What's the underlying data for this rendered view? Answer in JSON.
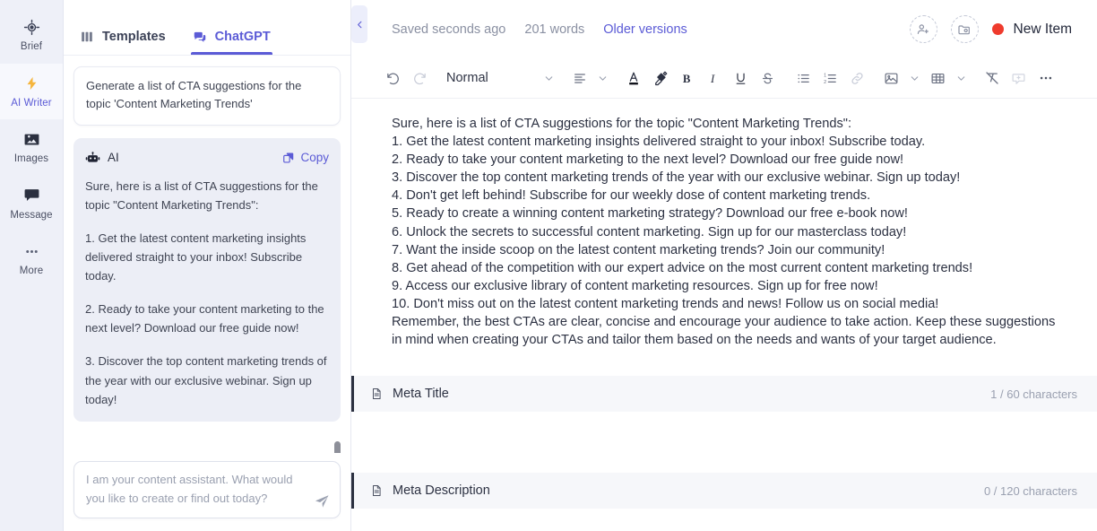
{
  "rail": {
    "items": [
      {
        "label": "Brief",
        "icon": "target-icon",
        "active": false
      },
      {
        "label": "AI Writer",
        "icon": "lightning-bolt-icon",
        "active": true
      },
      {
        "label": "Images",
        "icon": "image-icon",
        "active": false
      },
      {
        "label": "Message",
        "icon": "chat-bubble-icon",
        "active": false
      },
      {
        "label": "More",
        "icon": "ellipsis-icon",
        "active": false
      }
    ]
  },
  "chat": {
    "tabs": [
      {
        "label": "Templates",
        "icon": "grid-icon",
        "active": false
      },
      {
        "label": "ChatGPT",
        "icon": "chat-bubbles-icon",
        "active": true
      }
    ],
    "user_message": "Generate a list of CTA suggestions for the topic 'Content Marketing Trends'",
    "ai_name": "AI",
    "copy_label": "Copy",
    "ai_paragraphs": [
      "Sure, here is a list of CTA suggestions for the topic \"Content Marketing Trends\":",
      "1. Get the latest content marketing insights delivered straight to your inbox! Subscribe today.",
      "2. Ready to take your content marketing to the next level? Download our free guide now!",
      "3. Discover the top content marketing trends of the year with our exclusive webinar. Sign up today!"
    ],
    "input_placeholder": "I am your content assistant. What would you like to create or find out today?",
    "input_value": "",
    "send_icon": "send-icon",
    "collapse_icon": "chevron-left-icon"
  },
  "header": {
    "saved_status": "Saved seconds ago",
    "word_count": "201 words",
    "older_versions": "Older versions",
    "assign_user_icon": "add-user-icon",
    "add_item_icon": "add-folder-icon",
    "status_label": "New Item",
    "status_color": "#ef3b2d"
  },
  "toolbar": {
    "undo_icon": "undo-icon",
    "redo_icon": "redo-icon",
    "style_label": "Normal",
    "style_chevron_icon": "chevron-down-icon",
    "align_icon": "align-left-icon",
    "align_chevron_icon": "chevron-down-icon",
    "text_color_icon": "text-color-icon",
    "highlight_icon": "highlighter-icon",
    "bold_icon": "bold-icon",
    "italic_icon": "italic-icon",
    "underline_icon": "underline-icon",
    "strikethrough_icon": "strikethrough-icon",
    "bullet_list_icon": "bullet-list-icon",
    "numbered_list_icon": "numbered-list-icon",
    "link_icon": "link-icon",
    "image_icon": "image-icon",
    "image_chevron_icon": "chevron-down-icon",
    "table_icon": "table-icon",
    "table_chevron_icon": "chevron-down-icon",
    "clear_format_icon": "clear-formatting-icon",
    "comment_icon": "comment-icon",
    "more_icon": "ellipsis-icon"
  },
  "document": {
    "lines": [
      "Sure, here is a list of CTA suggestions for the topic \"Content Marketing Trends\":",
      "1. Get the latest content marketing insights delivered straight to your inbox! Subscribe today.",
      "2. Ready to take your content marketing to the next level? Download our free guide now!",
      "3. Discover the top content marketing trends of the year with our exclusive webinar. Sign up today!",
      "4. Don't get left behind! Subscribe for our weekly dose of content marketing trends.",
      "5. Ready to create a winning content marketing strategy? Download our free e-book now!",
      "6. Unlock the secrets to successful content marketing. Sign up for our masterclass today!",
      "7. Want the inside scoop on the latest content marketing trends? Join our community!",
      "8. Get ahead of the competition with our expert advice on the most current content marketing trends!",
      "9. Access our exclusive library of content marketing resources. Sign up for free now!",
      "10. Don't miss out on the latest content marketing trends and news! Follow us on social media!",
      "Remember, the best CTAs are clear, concise and encourage your audience to take action. Keep these suggestions in mind when creating your CTAs and tailor them based on the needs and wants of your target audience."
    ],
    "meta_title": {
      "label": "Meta Title",
      "counter": "1 / 60 characters",
      "icon": "document-icon"
    },
    "meta_description": {
      "label": "Meta Description",
      "counter": "0 / 120 characters",
      "icon": "document-icon"
    }
  }
}
